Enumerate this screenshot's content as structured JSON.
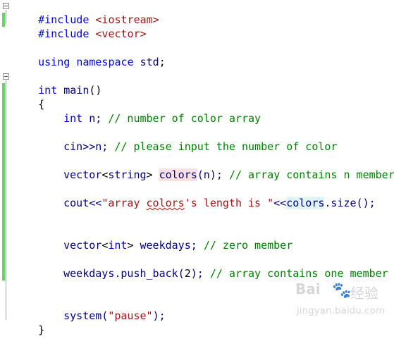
{
  "code": {
    "l1": {
      "directive": "#include",
      "header": "<iostream>"
    },
    "l2": {
      "directive": "#include",
      "header": "<vector>"
    },
    "l3": {
      "k1": "using",
      "k2": "namespace",
      "id": "std",
      "end": ";"
    },
    "l4": {
      "type": "int",
      "name": "main",
      "parens": "()"
    },
    "l5": {
      "brace": "{"
    },
    "l6": {
      "type": "int",
      "rest": " n;",
      "comment": "// number of color array"
    },
    "l7": {
      "code": "cin>>n;",
      "comment": "// please input the number of color"
    },
    "l8": {
      "a": "vector",
      "b": "<",
      "c": "string",
      "d": ">",
      "var": "colors",
      "e": "(n);",
      "comment": "// array contains n member"
    },
    "l9": {
      "a": "cout<<",
      "s1": "\"array ",
      "s2": "colors",
      "s3": "'s length is \"",
      "b": "<<",
      "var": "colors",
      "c": ".size();"
    },
    "l10": {
      "a": "vector",
      "b": "<",
      "c": "int",
      "d": ">",
      "e": " weekdays;",
      "comment": "// zero member"
    },
    "l11": {
      "a": "weekdays.push_back(",
      "num": "2",
      "b": ");",
      "comment": "// array contains one member"
    },
    "l12": {
      "a": "system(",
      "str": "\"pause\"",
      "b": ");"
    },
    "l13": {
      "brace": "}"
    }
  },
  "watermark": {
    "logo": "Bai",
    "paw": "🐾",
    "cn": "经验",
    "url": "jingyan.baidu.com"
  }
}
